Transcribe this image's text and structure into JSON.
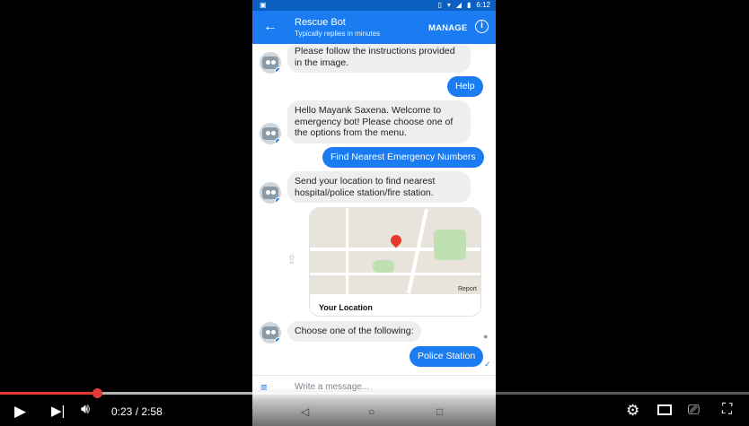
{
  "status": {
    "time": "6:12"
  },
  "appbar": {
    "title": "Rescue Bot",
    "subtitle": "Typically replies in minutes",
    "manage": "MANAGE"
  },
  "messages": {
    "m1": "Please follow the instructions provided in the image.",
    "m2": "Help",
    "m3": "Hello Mayank Saxena. Welcome to emergency bot! Please choose one of the options from the menu.",
    "m4": "Find Nearest Emergency Numbers",
    "m5": "Send your location to find nearest hospital/police station/fire station.",
    "m6": "Choose one of the following:",
    "m7": "Police Station"
  },
  "map": {
    "label": "Your Location",
    "report": "Report"
  },
  "composer": {
    "placeholder": "Write a message..."
  },
  "video": {
    "current": "0:23",
    "separator": "/",
    "duration": "2:58",
    "progress_fraction": 0.129,
    "buffer_fraction": 0.615
  },
  "icons": {
    "play": "play-icon",
    "next": "next-icon",
    "volume": "volume-icon",
    "settings": "gear-icon",
    "theater": "theater-icon",
    "cast": "cast-icon",
    "fullscreen": "fullscreen-icon"
  }
}
